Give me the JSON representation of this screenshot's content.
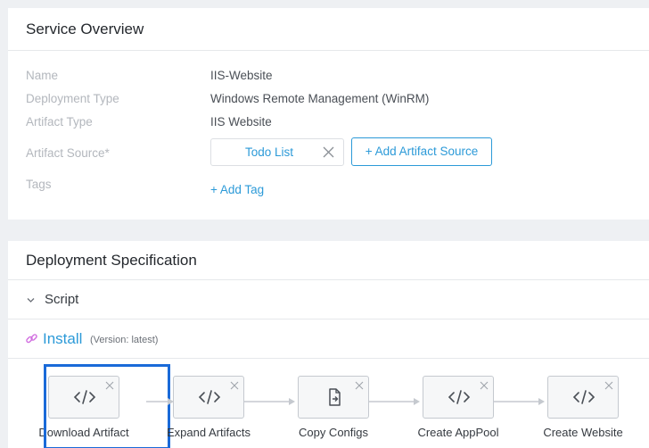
{
  "overview": {
    "title": "Service Overview",
    "fields": [
      {
        "label": "Name",
        "value": "IIS-Website"
      },
      {
        "label": "Deployment Type",
        "value": "Windows Remote Management (WinRM)"
      },
      {
        "label": "Artifact Type",
        "value": "IIS Website"
      },
      {
        "label": "Artifact Source*"
      },
      {
        "label": "Tags"
      }
    ],
    "artifact_source_chip": "Todo List",
    "add_artifact_source": "+ Add Artifact Source",
    "add_tag": "+ Add Tag"
  },
  "spec": {
    "title": "Deployment Specification",
    "script_label": "Script",
    "install_title": "Install",
    "install_version": "(Version: latest)",
    "steps": [
      {
        "label": "Download Artifact",
        "icon": "code-icon",
        "selected": true
      },
      {
        "label": "Expand Artifacts",
        "icon": "code-icon"
      },
      {
        "label": "Copy Configs",
        "icon": "file-copy-icon"
      },
      {
        "label": "Create AppPool",
        "icon": "code-icon"
      },
      {
        "label": "Create Website",
        "icon": "code-icon"
      }
    ]
  },
  "colors": {
    "accent": "#2c9ad8",
    "selection": "#1a6ad8",
    "label_gray": "#b3b7bd"
  }
}
